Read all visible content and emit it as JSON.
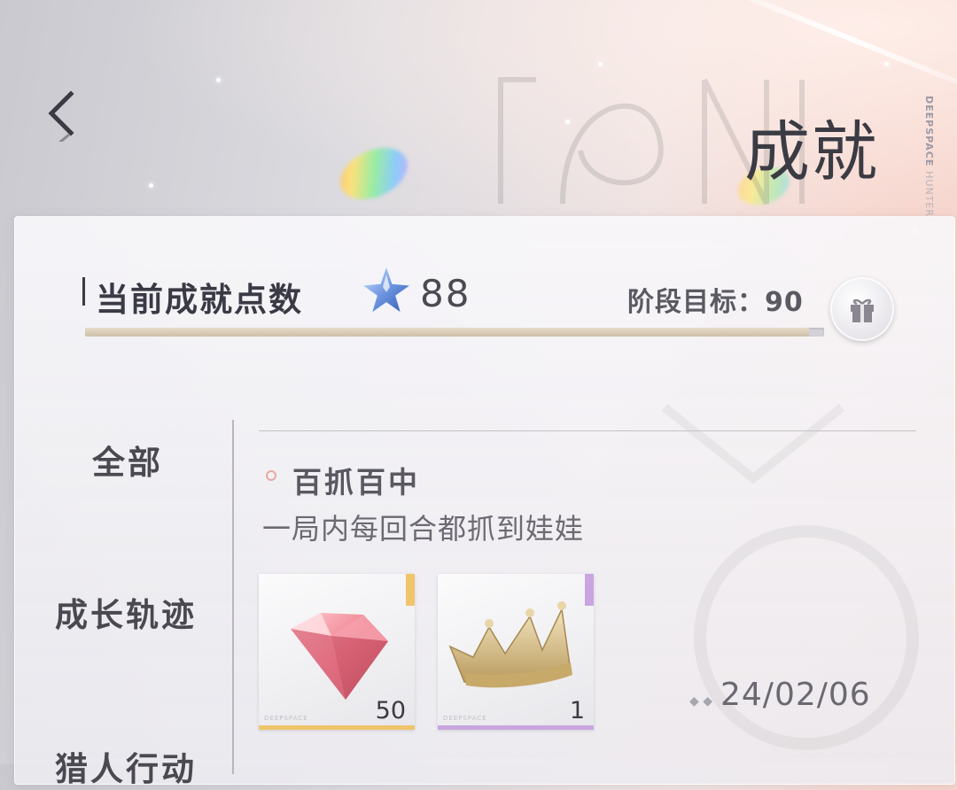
{
  "header": {
    "title": "成就",
    "brand_top": "DEEPSPACE",
    "brand_sub": "HUNTERS"
  },
  "points": {
    "label": "当前成就点数",
    "value": "88",
    "goal_text": "阶段目标：90",
    "progress": 0.98,
    "icon": "star-icon"
  },
  "sidebar": {
    "items": [
      {
        "label": "全部"
      },
      {
        "label": "成长轨迹"
      },
      {
        "label": "猎人行动"
      }
    ]
  },
  "achievement": {
    "title": "百抓百中",
    "description": "一局内每回合都抓到娃娃",
    "rewards": [
      {
        "name": "diamond",
        "count": "50",
        "accent": "#f0c46a",
        "brand": "DEEPSPACE"
      },
      {
        "name": "crown",
        "count": "1",
        "accent": "#c9a6e0",
        "brand": "DEEPSPACE"
      }
    ],
    "date": "24/02/06"
  },
  "colors": {
    "title": "#3b3b44",
    "accent_gold": "#f0c46a",
    "accent_purple": "#c9a6e0",
    "dot": "#e8a9a0"
  }
}
